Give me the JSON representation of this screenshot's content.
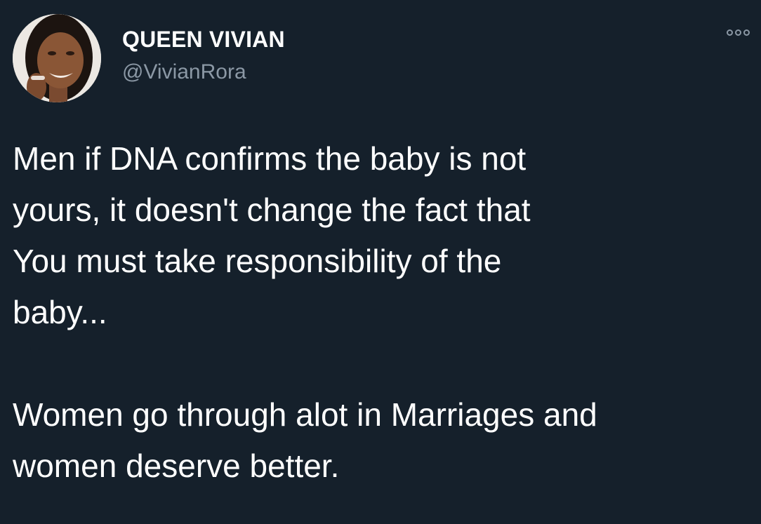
{
  "tweet": {
    "author": {
      "display_name": "QUEEN VIVIAN",
      "handle": "@VivianRora",
      "avatar_icon": "profile-photo"
    },
    "more_icon": "more-options-icon",
    "text": "Men if DNA confirms the baby is not\nyours, it doesn't change the fact that\nYou must take responsibility of the\nbaby...\n\nWomen go through alot in Marriages and\nwomen deserve better.",
    "colors": {
      "background": "#15202b",
      "text": "#ffffff",
      "secondary_text": "#8b98a5"
    }
  }
}
